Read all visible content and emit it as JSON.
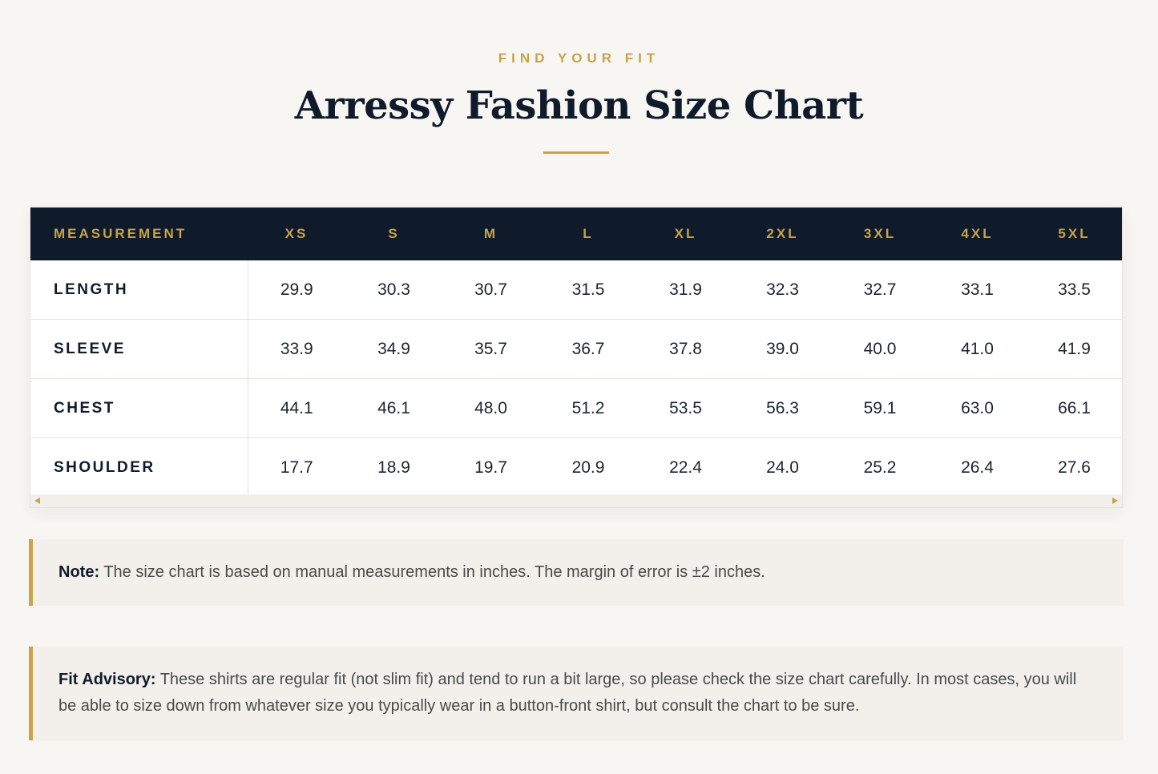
{
  "header": {
    "eyebrow": "FIND YOUR FIT",
    "title": "Arressy Fashion Size Chart"
  },
  "table": {
    "columns": [
      "MEASUREMENT",
      "XS",
      "S",
      "M",
      "L",
      "XL",
      "2XL",
      "3XL",
      "4XL",
      "5XL"
    ],
    "rows": [
      {
        "label": "LENGTH",
        "values": [
          "29.9",
          "30.3",
          "30.7",
          "31.5",
          "31.9",
          "32.3",
          "32.7",
          "33.1",
          "33.5"
        ]
      },
      {
        "label": "SLEEVE",
        "values": [
          "33.9",
          "34.9",
          "35.7",
          "36.7",
          "37.8",
          "39.0",
          "40.0",
          "41.0",
          "41.9"
        ]
      },
      {
        "label": "CHEST",
        "values": [
          "44.1",
          "46.1",
          "48.0",
          "51.2",
          "53.5",
          "56.3",
          "59.1",
          "63.0",
          "66.1"
        ]
      },
      {
        "label": "SHOULDER",
        "values": [
          "17.7",
          "18.9",
          "19.7",
          "20.9",
          "22.4",
          "24.0",
          "25.2",
          "26.4",
          "27.6"
        ]
      }
    ]
  },
  "notes": {
    "note_label": "Note:",
    "note_text": "The size chart is based on manual measurements in inches. The margin of error is ±2 inches.",
    "fit_label": "Fit Advisory:",
    "fit_text": "These shirts are regular fit (not slim fit) and tend to run a bit large, so please check the size chart carefully. In most cases, you will be able to size down from whatever size you typically wear in a button-front shirt, but consult the chart to be sure."
  },
  "colors": {
    "navy": "#0f1b2b",
    "gold": "#c9a24a",
    "background": "#f8f6f2",
    "note_background": "#f3f0eb"
  }
}
